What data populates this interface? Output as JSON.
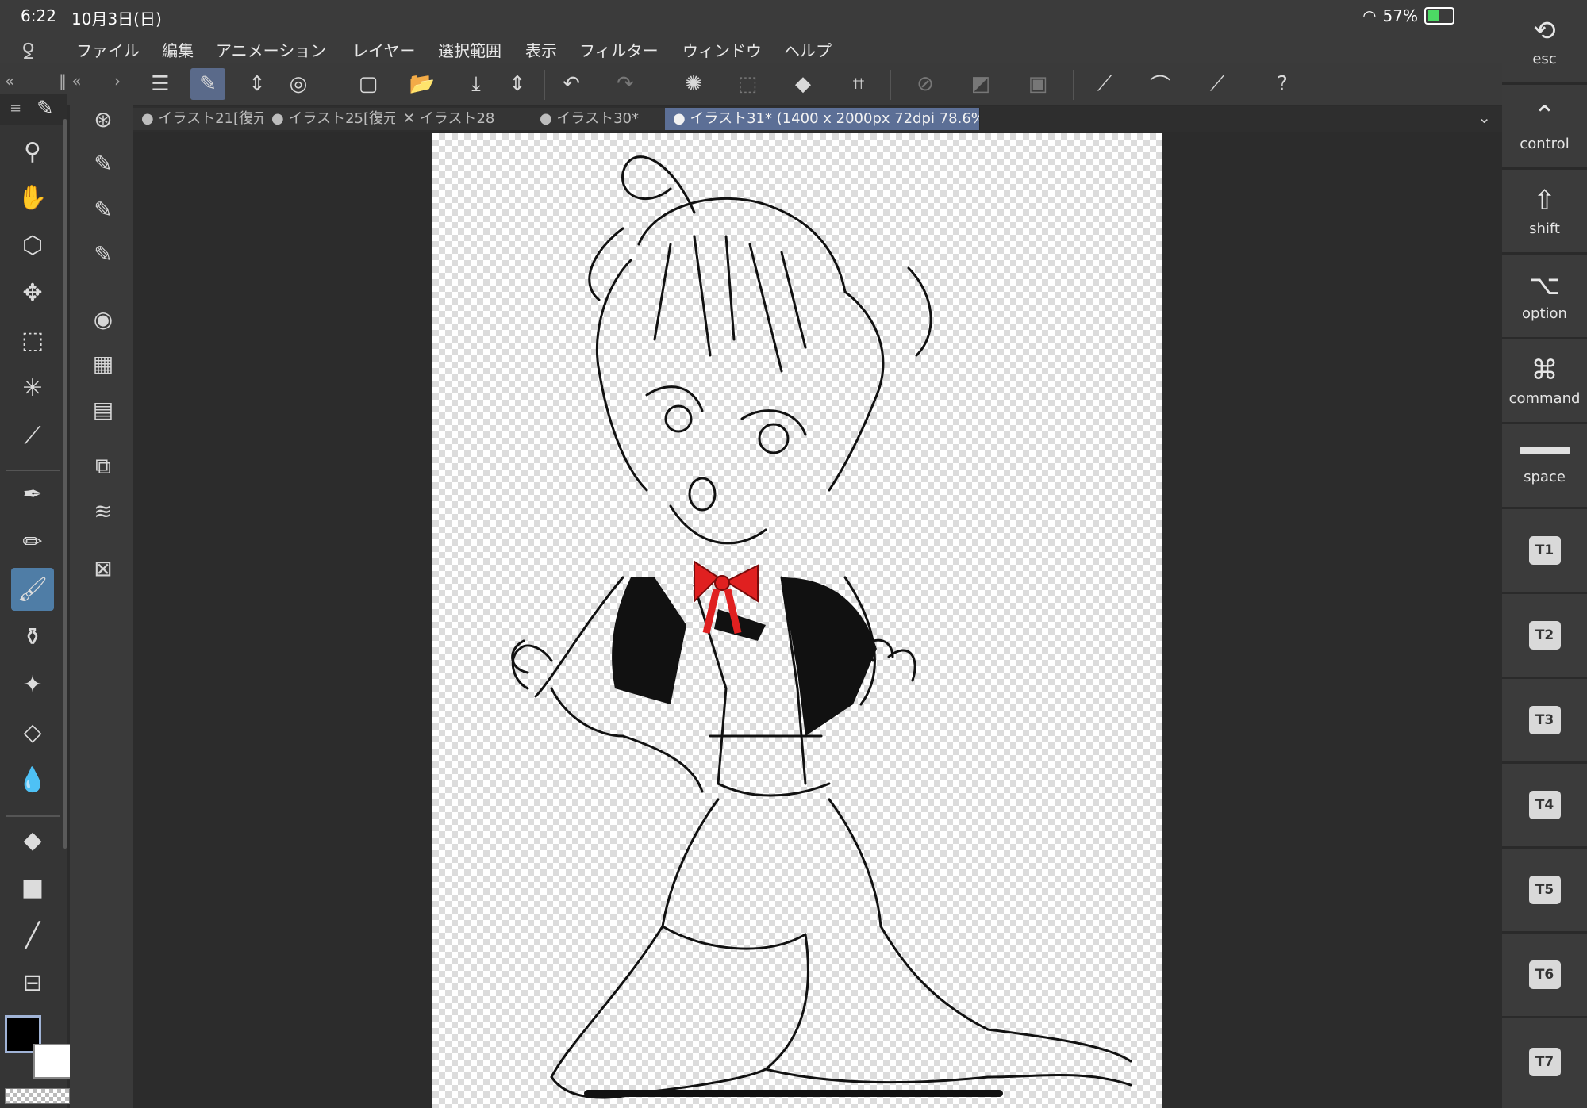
{
  "status": {
    "time": "6:22",
    "date": "10月3日(日)",
    "battery": "57%",
    "battery_level": 0.57
  },
  "menu": [
    "ファイル",
    "編集",
    "アニメーション",
    "レイヤー",
    "選択範囲",
    "表示",
    "フィルター",
    "ウィンドウ",
    "ヘルプ"
  ],
  "tabs": [
    {
      "label": "● イラスト21[復元",
      "active": false
    },
    {
      "label": "● イラスト25[復元",
      "active": false
    },
    {
      "label": "✕ イラスト28",
      "active": false
    },
    {
      "label": "● イラスト30*",
      "active": false
    },
    {
      "label": "● イラスト31* (1400 x 2000px 72dpi 78.6%)",
      "active": true
    }
  ],
  "modifier_keys": [
    {
      "symbol": "⟲",
      "label": "esc"
    },
    {
      "symbol": "⌃",
      "label": "control"
    },
    {
      "symbol": "⇧",
      "label": "shift"
    },
    {
      "symbol": "⌥",
      "label": "option"
    },
    {
      "symbol": "⌘",
      "label": "command"
    },
    {
      "symbol": "",
      "label": "space"
    },
    {
      "symbol": "T1",
      "label": ""
    },
    {
      "symbol": "T2",
      "label": ""
    },
    {
      "symbol": "T3",
      "label": ""
    },
    {
      "symbol": "T4",
      "label": ""
    },
    {
      "symbol": "T5",
      "label": ""
    },
    {
      "symbol": "T6",
      "label": ""
    },
    {
      "symbol": "T7",
      "label": ""
    }
  ],
  "colors": {
    "main": "#000000",
    "sub": "#ffffff",
    "accent": "#5c6f96",
    "active_tool": "#4f7da6",
    "bow": "#e02020"
  }
}
